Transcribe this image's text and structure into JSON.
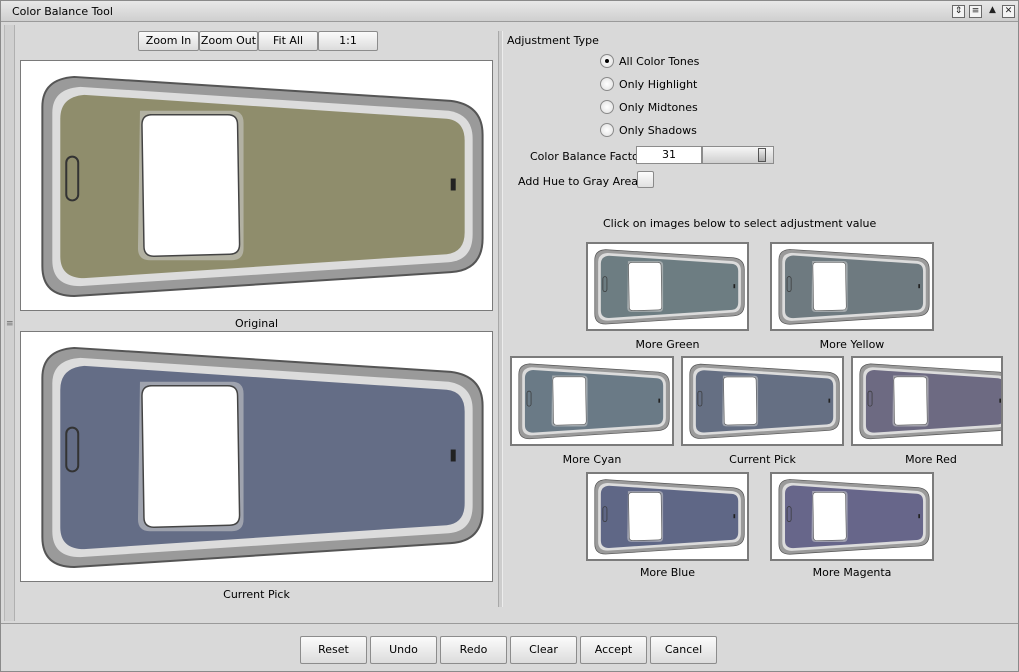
{
  "window": {
    "title": "Color Balance Tool",
    "controls": {
      "restore_glyph": "⇕",
      "menu_glyph": "≡",
      "minimize_glyph": "▲",
      "close_glyph": "✕"
    }
  },
  "splitter_grip": "≡",
  "toolbar": {
    "zoom_in": "Zoom In",
    "zoom_out": "Zoom Out",
    "fit_all": "Fit All",
    "one_to_one": "1:1"
  },
  "preview": {
    "original_caption": "Original",
    "current_caption": "Current Pick"
  },
  "adjustment": {
    "heading": "Adjustment Type",
    "options": [
      {
        "label": "All Color Tones",
        "selected": true
      },
      {
        "label": "Only Highlight",
        "selected": false
      },
      {
        "label": "Only Midtones",
        "selected": false
      },
      {
        "label": "Only Shadows",
        "selected": false
      }
    ],
    "factor_label": "Color Balance Factor",
    "factor_value": "31",
    "gray_label": "Add Hue to Gray Areas",
    "instructions": "Click on images below to select adjustment value"
  },
  "variations": [
    {
      "label": "More Green",
      "tint": "#6d7d82"
    },
    {
      "label": "More Yellow",
      "tint": "#6e7a80"
    },
    {
      "label": "More Cyan",
      "tint": "#6a7a86"
    },
    {
      "label": "Current Pick",
      "tint": "#656f83"
    },
    {
      "label": "More Red",
      "tint": "#6d6a82"
    },
    {
      "label": "More Blue",
      "tint": "#5f6786"
    },
    {
      "label": "More Magenta",
      "tint": "#67668a"
    }
  ],
  "colors": {
    "original_body": "#8f8d6c",
    "current_body": "#646d86"
  },
  "actions": {
    "reset": "Reset",
    "undo": "Undo",
    "redo": "Redo",
    "clear": "Clear",
    "accept": "Accept",
    "cancel": "Cancel"
  }
}
